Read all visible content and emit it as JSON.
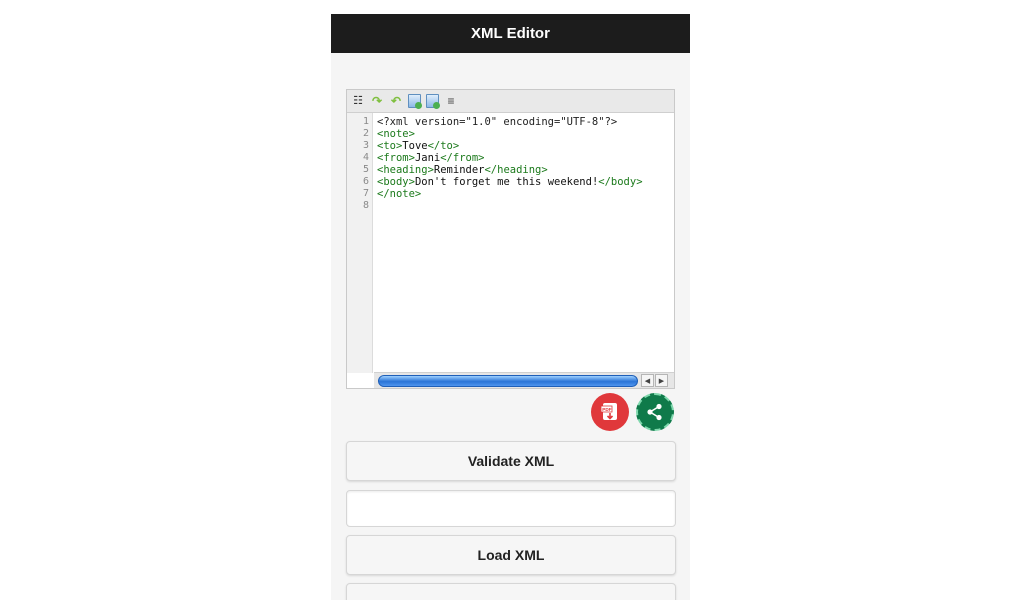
{
  "header": {
    "title": "XML Editor"
  },
  "editor": {
    "line_numbers": [
      "1",
      "2",
      "3",
      "4",
      "5",
      "6",
      "7",
      "8"
    ],
    "lines": [
      [
        {
          "t": "decl",
          "v": "<?xml version=\"1.0\" encoding=\"UTF-8\"?>"
        }
      ],
      [
        {
          "t": "tag",
          "v": "<note>"
        }
      ],
      [
        {
          "t": "tag",
          "v": "<to>"
        },
        {
          "t": "txt",
          "v": "Tove"
        },
        {
          "t": "tag",
          "v": "</to>"
        }
      ],
      [
        {
          "t": "tag",
          "v": "<from>"
        },
        {
          "t": "txt",
          "v": "Jani"
        },
        {
          "t": "tag",
          "v": "</from>"
        }
      ],
      [
        {
          "t": "tag",
          "v": "<heading>"
        },
        {
          "t": "txt",
          "v": "Reminder"
        },
        {
          "t": "tag",
          "v": "</heading>"
        }
      ],
      [
        {
          "t": "tag",
          "v": "<body>"
        },
        {
          "t": "txt",
          "v": "Don't forget me this weekend!"
        },
        {
          "t": "tag",
          "v": "</body>"
        }
      ],
      [
        {
          "t": "tag",
          "v": "</note>"
        }
      ],
      []
    ]
  },
  "buttons": {
    "validate_label": "Validate XML",
    "load_label": "Load XML"
  },
  "input": {
    "value": ""
  },
  "colors": {
    "header_bg": "#1c1c1c",
    "tag": "#1c7a1c",
    "pdf_button": "#e0383b",
    "share_button": "#0f7a4a"
  },
  "icons": {
    "toolbar": [
      "search-icon",
      "undo-icon",
      "redo-icon",
      "open-file-icon",
      "refresh-file-icon",
      "format-icon"
    ],
    "pdf": "pdf-download-icon",
    "share": "share-icon"
  }
}
